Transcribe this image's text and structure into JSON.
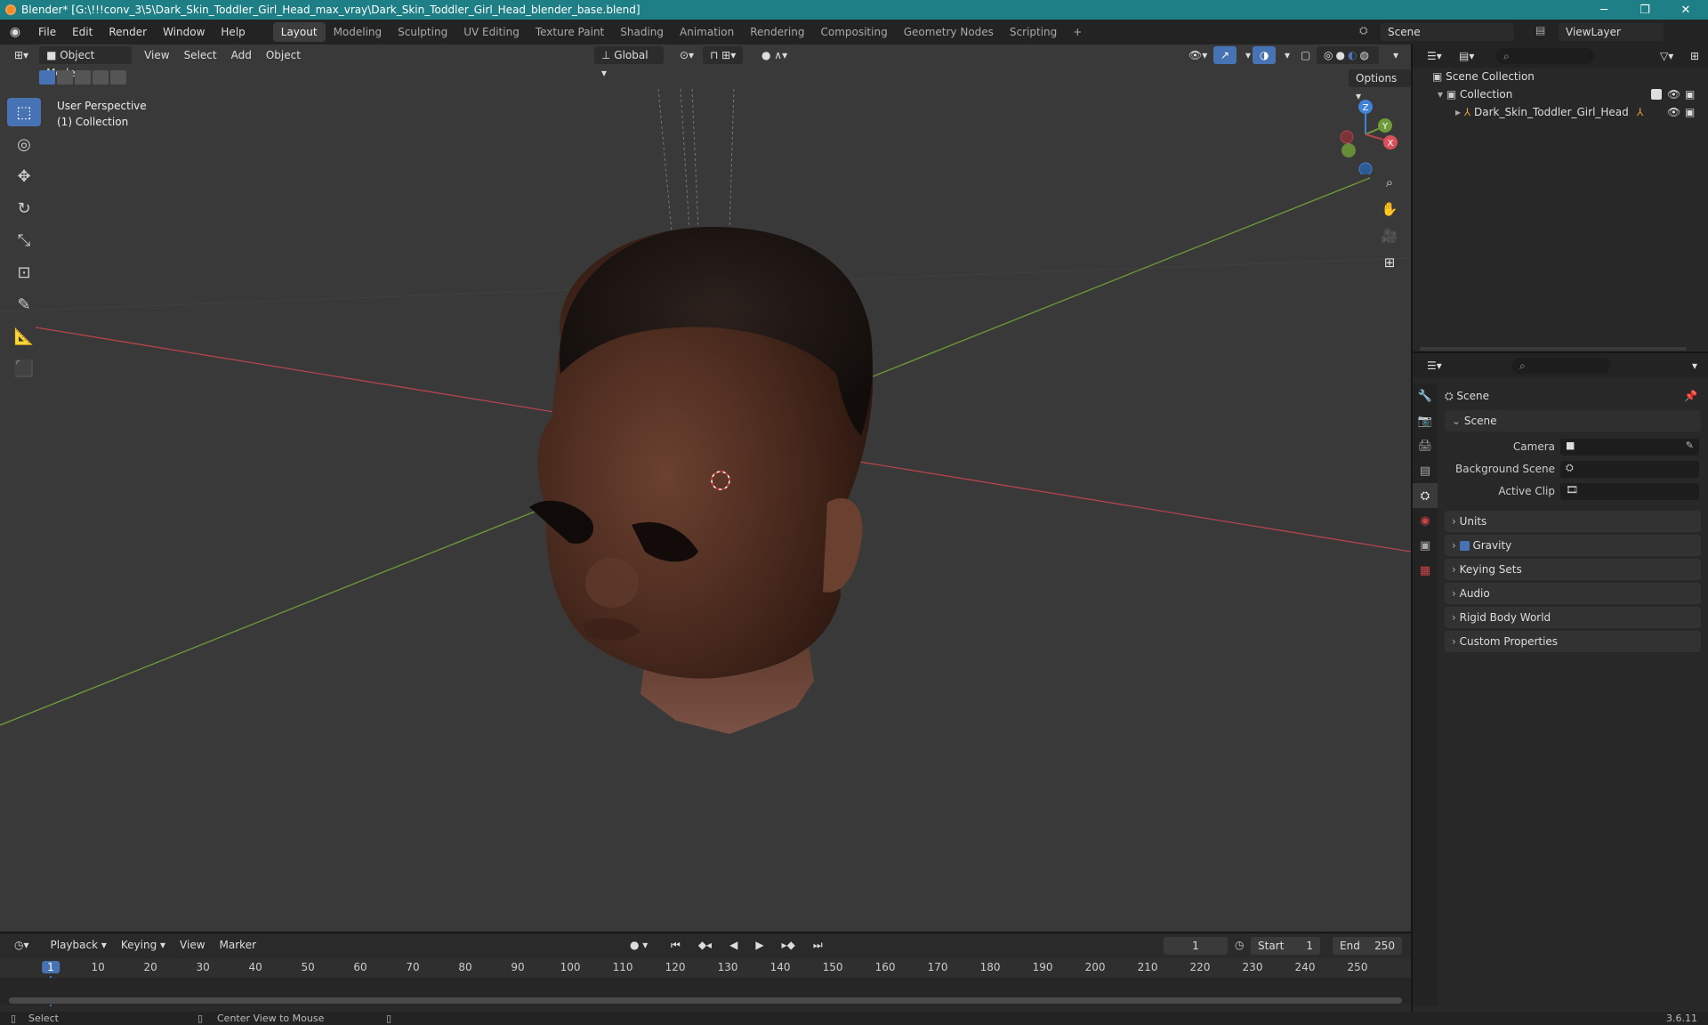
{
  "window": {
    "title": "Blender* [G:\\!!!conv_3\\5\\Dark_Skin_Toddler_Girl_Head_max_vray\\Dark_Skin_Toddler_Girl_Head_blender_base.blend]",
    "minimize": "─",
    "restore": "❐",
    "close": "✕"
  },
  "menubar": {
    "menus": [
      "File",
      "Edit",
      "Render",
      "Window",
      "Help"
    ],
    "workspaces": [
      "Layout",
      "Modeling",
      "Sculpting",
      "UV Editing",
      "Texture Paint",
      "Shading",
      "Animation",
      "Rendering",
      "Compositing",
      "Geometry Nodes",
      "Scripting"
    ],
    "active_workspace": "Layout",
    "add_tab": "+",
    "scene": "Scene",
    "view_layer": "ViewLayer"
  },
  "viewport": {
    "mode": "Object Mode",
    "menus": [
      "View",
      "Select",
      "Add",
      "Object"
    ],
    "transform_orientation": "Global",
    "options": "Options",
    "overlay_line1": "User Perspective",
    "overlay_line2": "(1) Collection",
    "gizmo": {
      "x": "X",
      "y": "Y",
      "z": "Z"
    }
  },
  "timeline": {
    "menus": [
      "Playback",
      "Keying",
      "View",
      "Marker"
    ],
    "current_frame": "1",
    "start_label": "Start",
    "start": "1",
    "end_label": "End",
    "end": "250",
    "ticks": [
      "1",
      "10",
      "20",
      "30",
      "40",
      "50",
      "60",
      "70",
      "80",
      "90",
      "100",
      "110",
      "120",
      "130",
      "140",
      "150",
      "160",
      "170",
      "180",
      "190",
      "200",
      "210",
      "220",
      "230",
      "240",
      "250"
    ]
  },
  "statusbar": {
    "select": "Select",
    "center_view": "Center View to Mouse",
    "version": "3.6.11"
  },
  "outliner": {
    "scene_collection": "Scene Collection",
    "collection": "Collection",
    "object": "Dark_Skin_Toddler_Girl_Head"
  },
  "properties": {
    "context": "Scene",
    "panel_scene": "Scene",
    "fields": [
      {
        "label": "Camera"
      },
      {
        "label": "Background Scene"
      },
      {
        "label": "Active Clip"
      }
    ],
    "panels": [
      "Units",
      "Gravity",
      "Keying Sets",
      "Audio",
      "Rigid Body World",
      "Custom Properties"
    ]
  },
  "colors": {
    "accent": "#4772b3",
    "titlebar": "#1f7f86",
    "x_axis": "#b4444c",
    "y_axis": "#6f9a3a",
    "z_axis": "#3f82d6",
    "playhead": "#4772b3"
  }
}
